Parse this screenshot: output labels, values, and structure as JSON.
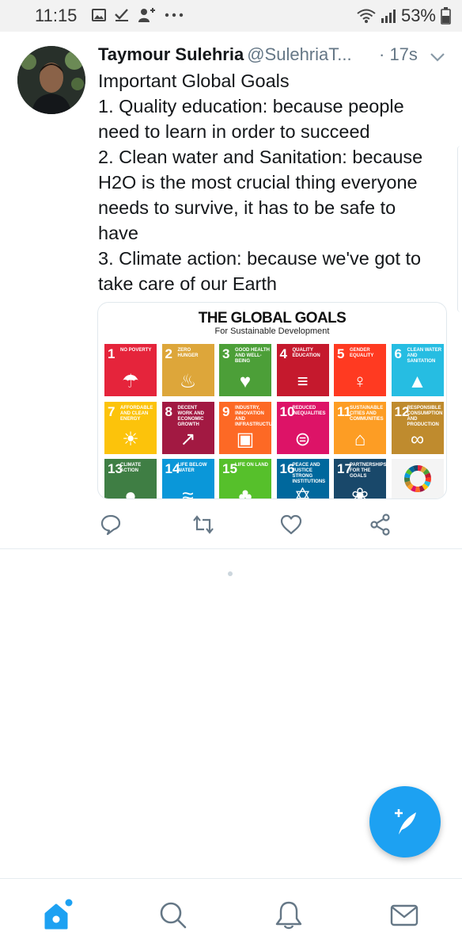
{
  "status_bar": {
    "time": "11:15",
    "battery_percent": "53%",
    "icons": [
      "image-icon",
      "check-icon",
      "add-person-icon",
      "more-dots-icon",
      "wifi-icon",
      "signal-icon",
      "battery-icon"
    ]
  },
  "tweet": {
    "author_name": "Taymour Sulehria",
    "author_handle": "@SulehriaT...",
    "timestamp": "· 17s",
    "lines": [
      "Important Global Goals",
      "1. Quality education: because people",
      "need to learn in order to succeed",
      "2. Clean water and Sanitation: because",
      "H2O is the most crucial thing everyone",
      "needs to survive, it has to be safe to",
      "have",
      "3. Climate action: because we've got to",
      "take care of our Earth"
    ],
    "media": {
      "title": "THE GLOBAL GOALS",
      "subtitle": "For Sustainable Development",
      "tiles": [
        {
          "num": "1",
          "label": "NO POVERTY",
          "color": "#e5243b"
        },
        {
          "num": "2",
          "label": "ZERO HUNGER",
          "color": "#dda63a"
        },
        {
          "num": "3",
          "label": "GOOD HEALTH AND WELL-BEING",
          "color": "#4c9f38"
        },
        {
          "num": "4",
          "label": "QUALITY EDUCATION",
          "color": "#c5192d"
        },
        {
          "num": "5",
          "label": "GENDER EQUALITY",
          "color": "#ff3a21"
        },
        {
          "num": "6",
          "label": "CLEAN WATER AND SANITATION",
          "color": "#26bde2"
        },
        {
          "num": "7",
          "label": "AFFORDABLE AND CLEAN ENERGY",
          "color": "#fcc30b"
        },
        {
          "num": "8",
          "label": "DECENT WORK AND ECONOMIC GROWTH",
          "color": "#a21942"
        },
        {
          "num": "9",
          "label": "INDUSTRY, INNOVATION AND INFRASTRUCTURE",
          "color": "#fd6925"
        },
        {
          "num": "10",
          "label": "REDUCED INEQUALITIES",
          "color": "#dd1367"
        },
        {
          "num": "11",
          "label": "SUSTAINABLE CITIES AND COMMUNITIES",
          "color": "#fd9d24"
        },
        {
          "num": "12",
          "label": "RESPONSIBLE CONSUMPTION AND PRODUCTION",
          "color": "#bf8b2e"
        },
        {
          "num": "13",
          "label": "CLIMATE ACTION",
          "color": "#3f7e44"
        },
        {
          "num": "14",
          "label": "LIFE BELOW WATER",
          "color": "#0a97d9"
        },
        {
          "num": "15",
          "label": "LIFE ON LAND",
          "color": "#56c02b"
        },
        {
          "num": "16",
          "label": "PEACE AND JUSTICE STRONG INSTITUTIONS",
          "color": "#00689d"
        },
        {
          "num": "17",
          "label": "PARTNERSHIPS FOR THE GOALS",
          "color": "#19486a"
        }
      ],
      "logo_text": "THE GLOBAL GOALS"
    },
    "actions": [
      "reply-icon",
      "retweet-icon",
      "like-icon",
      "share-icon"
    ]
  },
  "bottom_nav": [
    "home-icon",
    "search-icon",
    "notifications-icon",
    "messages-icon"
  ],
  "colors": {
    "accent": "#1da1f2",
    "icon_gray": "#657786"
  }
}
